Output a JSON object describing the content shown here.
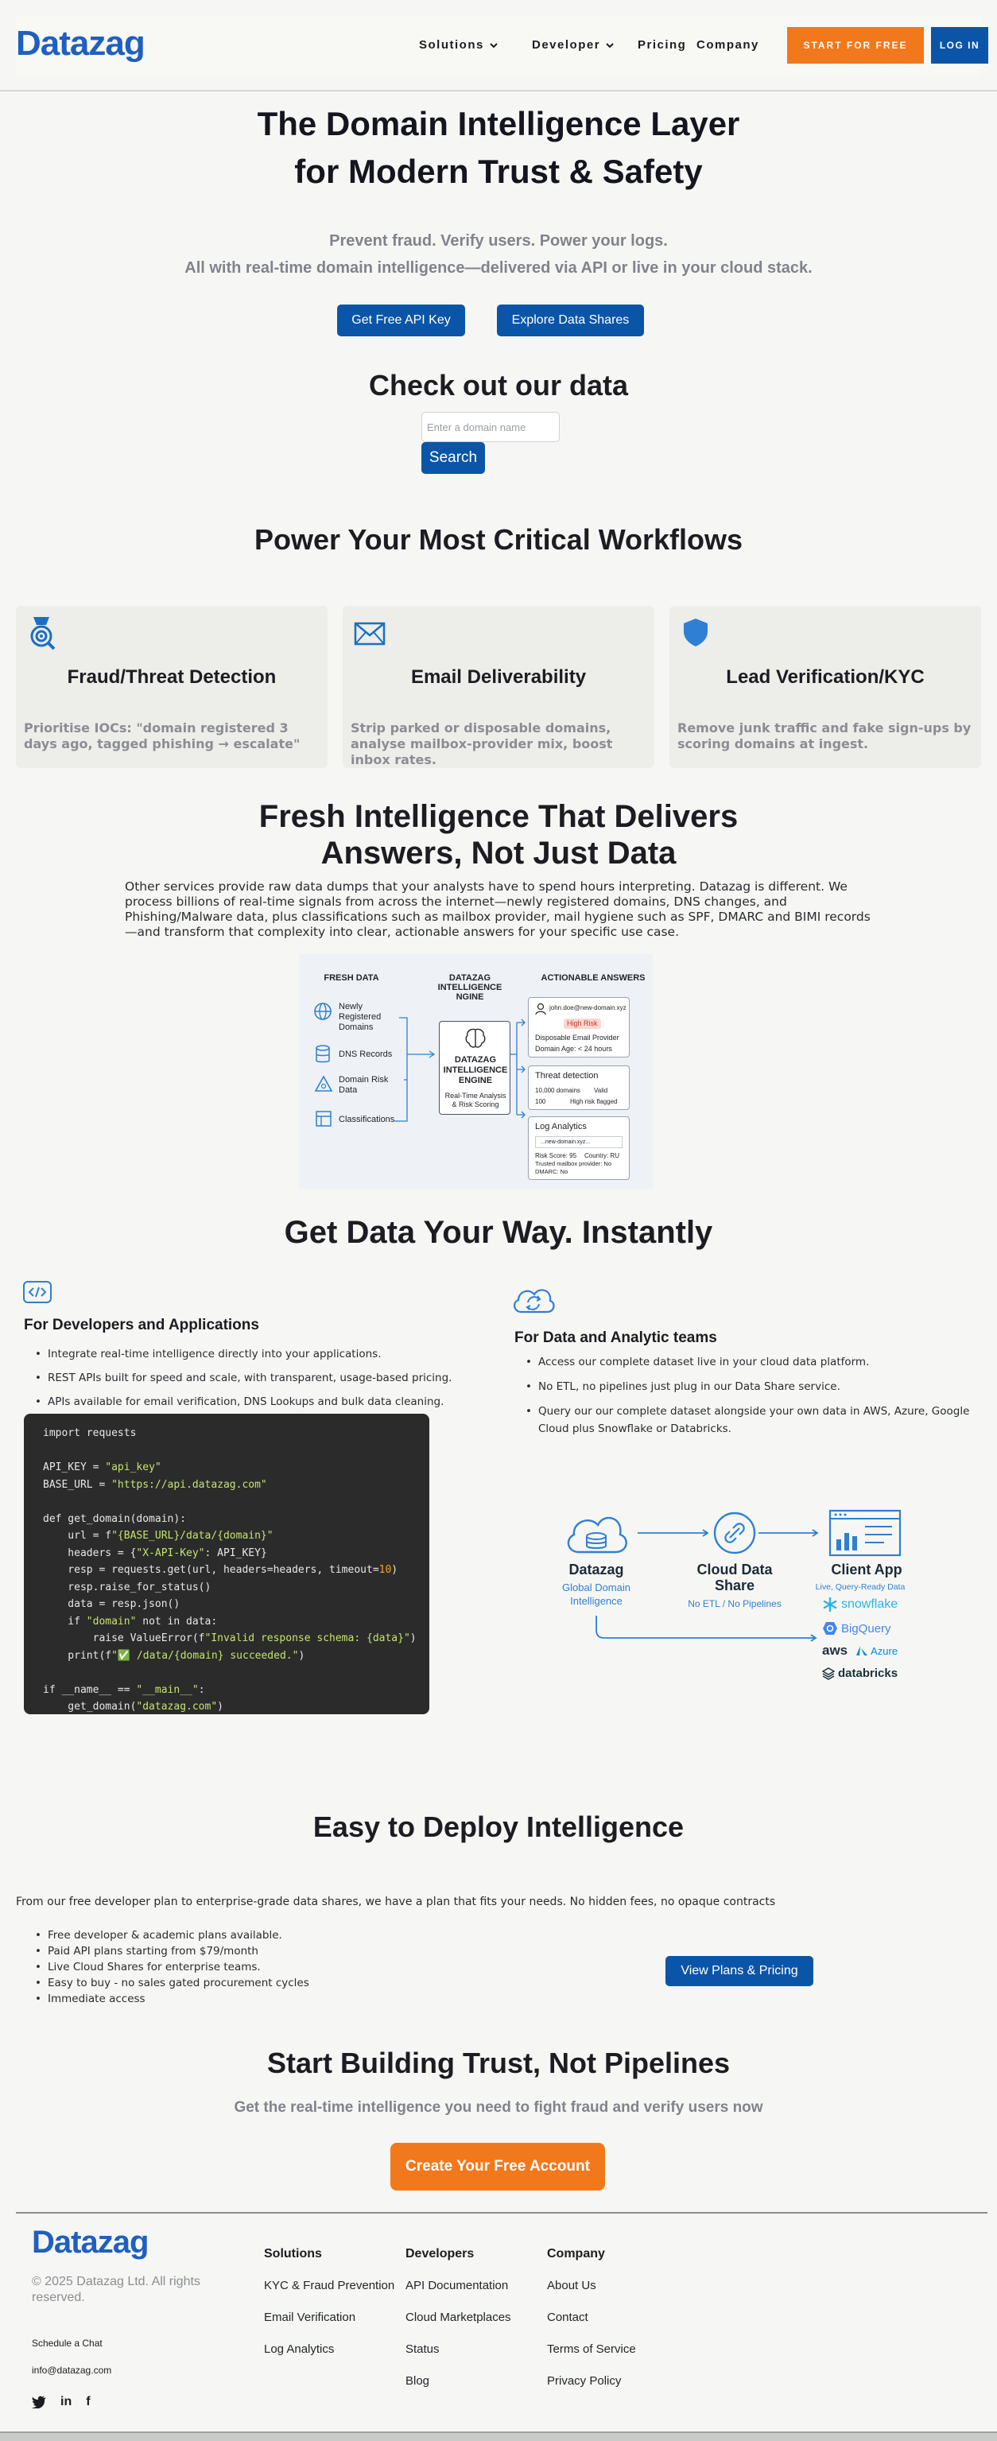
{
  "nav": {
    "logo": "Datazag",
    "links": [
      "Solutions",
      "Developer",
      "Pricing",
      "Company"
    ],
    "cta": "START FOR FREE",
    "login": "LOG IN"
  },
  "hero": {
    "title_line1": "The Domain Intelligence Layer",
    "title_line2": "for Modern Trust & Safety",
    "sub1": "Prevent fraud. Verify users. Power your logs.",
    "sub2": "All with real-time domain intelligence—delivered via API or live in your cloud stack.",
    "btn_api": "Get Free API Key",
    "btn_shares": "Explore Data Shares"
  },
  "search": {
    "title": "Check out our data",
    "placeholder": "Enter a domain name",
    "button": "Search"
  },
  "workflows": {
    "title": "Power Your Most Critical  Workflows",
    "cards": [
      {
        "icon": "target-icon",
        "title": "Fraud/Threat Detection",
        "text": "Prioritise IOCs: \"domain registered 3 days ago, tagged phishing → escalate\""
      },
      {
        "icon": "envelope-icon",
        "title": "Email Deliverability",
        "text": "Strip parked or disposable domains, analyse mailbox-provider mix, boost inbox rates."
      },
      {
        "icon": "shield-icon",
        "title": "Lead Verification/KYC",
        "text": "Remove junk traffic and fake sign-ups by scoring domains at ingest."
      }
    ]
  },
  "fresh": {
    "title_line1": "Fresh Intelligence That Delivers",
    "title_line2": "Answers, Not Just Data",
    "body": "Other services provide raw data dumps that your analysts have to spend hours interpreting. Datazag is different. We process billions of real-time signals from across the internet—newly registered domains, DNS changes, and Phishing/Malware data, plus classifications such as mailbox provider, mail hygiene such as SPF, DMARC and BIMI records —and transform that complexity into clear, actionable answers for your specific use case.",
    "diagram": {
      "col1": "FRESH DATA",
      "col2": "DATAZAG INTELLIGENCE NGINE",
      "col3": "ACTIONABLE ANSWERS",
      "inputs": [
        "Newly Registered Domains",
        "DNS Records",
        "Domain Risk Data",
        "Classifications"
      ],
      "engine_title": "DATAZAG INTELLIGENCE ENGINE",
      "engine_sub": "Real-Time Analysis & Risk Scoring",
      "a1_email": "john.doe@new-domain.xyz",
      "a1_badge": "High Risk",
      "a1_l1": "Disposable Email Provider",
      "a1_l2": "Domain Age: < 24 hours",
      "a2_title": "Threat detection",
      "a2_l1a": "10,000 domains",
      "a2_l1b": "Valid",
      "a2_l2a": "100",
      "a2_l2b": "High risk flagged",
      "a3_title": "Log Analytics",
      "a3_search": "...new-domain.xyz...",
      "a3_l1a": "Risk Score: 95",
      "a3_l1b": "Country: RU",
      "a3_l2": "Trusted mailbox provider: No",
      "a3_l3": "DMARC: No"
    }
  },
  "getdata": {
    "title": "Get Data Your Way. Instantly",
    "dev_title": "For Developers and Applications",
    "dev_bullets": [
      "Integrate real-time intelligence directly into your applications.",
      "REST APIs  built for speed and scale, with transparent, usage-based pricing.",
      "APIs available for email verification, DNS Lookups and bulk data cleaning."
    ],
    "data_title": "For Data and Analytic teams",
    "data_bullets": [
      "Access our complete dataset live in your cloud data platform.",
      "No ETL, no pipelines just plug in our Data Share service.",
      "Query our our complete dataset alongside your own data in AWS, Azure, Google Cloud plus Snowflake or Databricks."
    ],
    "flow": {
      "n1": "Datazag",
      "n1_sub": "Global Domain Intelligence",
      "n2": "Cloud Data Share",
      "n2_sub": "No ETL / No Pipelines",
      "n3": "Client App",
      "n3_sub": "Live, Query-Ready Data",
      "logos": [
        "snowflake",
        "BigQuery",
        "aws",
        "Azure",
        "databricks"
      ]
    }
  },
  "code": {
    "l1": "import requests",
    "l3a": "API_KEY = ",
    "l3b": "\"api_key\"",
    "l4a": "BASE_URL = ",
    "l4b": "\"https://api.datazag.com\"",
    "l6": "def get_domain(domain):",
    "l7a": "    url = f",
    "l7b": "\"{BASE_URL}/data/{domain}\"",
    "l8a": "    headers = {",
    "l8b": "\"X-API-Key\"",
    "l8c": ": API_KEY}",
    "l9a": "    resp = requests.get(url, headers=headers, timeout=",
    "l9b": "10",
    "l9c": ")",
    "l10": "    resp.raise_for_status()",
    "l11": "    data = resp.json()",
    "l12a": "    if ",
    "l12b": "\"domain\"",
    "l12c": " not in data:",
    "l13a": "        raise ValueError(f",
    "l13b": "\"Invalid response schema: {data}\"",
    "l13c": ")",
    "l14a": "    print(f",
    "l14b": "\"",
    "l14c": "✅",
    "l14d": " /data/{domain} succeeded.\"",
    "l14e": ")",
    "l16a": "if __name__ == ",
    "l16b": "\"__main__\"",
    "l16c": ":",
    "l17a": "    get_domain(",
    "l17b": "\"datazag.com\"",
    "l17c": ")"
  },
  "deploy": {
    "title": "Easy to Deploy Intelligence",
    "intro": "From our free developer plan to enterprise-grade data shares, we have a plan that fits your needs. No hidden fees, no opaque contracts",
    "bullets": [
      "Free developer & academic plans available.",
      "Paid API plans starting from $79/month",
      "Live Cloud Shares for enterprise teams.",
      "Easy to buy - no sales gated procurement cycles",
      "Immediate access"
    ],
    "button": "View Plans & Pricing"
  },
  "cta": {
    "title": "Start Building Trust, Not Pipelines",
    "sub": "Get the real-time intelligence you need to fight fraud and verify users now",
    "button": "Create Your Free Account"
  },
  "footer": {
    "logo": "Datazag",
    "copyright": "© 2025 Datazag Ltd. All rights reserved.",
    "chat": "Schedule a Chat",
    "email": "info@datazag.com",
    "cols": [
      {
        "title": "Solutions",
        "links": [
          "KYC & Fraud Prevention",
          "Email Verification",
          "Log Analytics"
        ]
      },
      {
        "title": "Developers",
        "links": [
          "API Documentation",
          "Cloud Marketplaces",
          "Status",
          "Blog"
        ]
      },
      {
        "title": "Company",
        "links": [
          "About  Us",
          "Contact",
          "Terms of Service",
          "Privacy Policy"
        ]
      }
    ],
    "social": [
      "twitter-icon",
      "linkedin-icon",
      "facebook-icon"
    ]
  },
  "colors": {
    "accent_blue": "#0b55a8",
    "brand_blue": "#1f5fbf",
    "cta_orange": "#f2781c"
  }
}
